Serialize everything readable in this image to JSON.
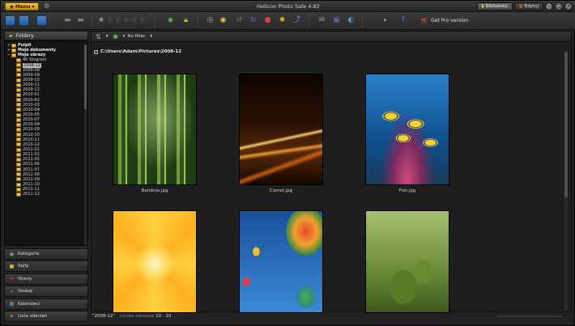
{
  "titlebar": {
    "menu_label": "Menu",
    "app_title": "Helicon Photo Safe 4.82",
    "biblioteka": "Biblioteka",
    "edytuj": "Edytuj"
  },
  "toolbar": {
    "get_pro": "Get Pro version"
  },
  "sidebar": {
    "folders_header": "Foldery",
    "tree": [
      {
        "label": "Pulpit",
        "level": 0,
        "bold": true,
        "exp": "+"
      },
      {
        "label": "Moje dokumenty",
        "level": 0,
        "bold": true,
        "exp": "+"
      },
      {
        "label": "Moje obrazy",
        "level": 0,
        "bold": true,
        "exp": "−"
      },
      {
        "label": "4K Stogram",
        "level": 1
      },
      {
        "label": "2008-12",
        "level": 1,
        "selected": true
      },
      {
        "label": "2009-08",
        "level": 1
      },
      {
        "label": "2009-09",
        "level": 1
      },
      {
        "label": "2009-10",
        "level": 1
      },
      {
        "label": "2009-11",
        "level": 1
      },
      {
        "label": "2009-12",
        "level": 1
      },
      {
        "label": "2010-01",
        "level": 1
      },
      {
        "label": "2010-02",
        "level": 1
      },
      {
        "label": "2010-03",
        "level": 1
      },
      {
        "label": "2010-04",
        "level": 1
      },
      {
        "label": "2010-05",
        "level": 1
      },
      {
        "label": "2010-07",
        "level": 1
      },
      {
        "label": "2010-08",
        "level": 1
      },
      {
        "label": "2010-09",
        "level": 1
      },
      {
        "label": "2010-10",
        "level": 1
      },
      {
        "label": "2010-11",
        "level": 1
      },
      {
        "label": "2010-12",
        "level": 1
      },
      {
        "label": "2011-01",
        "level": 1
      },
      {
        "label": "2011-02",
        "level": 1
      },
      {
        "label": "2011-05",
        "level": 1
      },
      {
        "label": "2011-06",
        "level": 1
      },
      {
        "label": "2011-07",
        "level": 1
      },
      {
        "label": "2011-08",
        "level": 1
      },
      {
        "label": "2011-09",
        "level": 1
      },
      {
        "label": "2011-10",
        "level": 1
      },
      {
        "label": "2011-11",
        "level": 1
      },
      {
        "label": "2011-12",
        "level": 1
      }
    ],
    "nav": [
      {
        "label": "Kategorie",
        "icon": "tag-icon",
        "color": "#4caf50",
        "glyph": "●"
      },
      {
        "label": "Sejfy",
        "icon": "safe-icon",
        "color": "#e0b030",
        "glyph": "■"
      },
      {
        "label": "Oceny",
        "icon": "rating-icon",
        "color": "#d03030",
        "glyph": "★"
      },
      {
        "label": "Szukaj",
        "icon": "search-icon",
        "color": "#aaaaaa",
        "glyph": "⌕"
      },
      {
        "label": "Kalendarz",
        "icon": "calendar-icon",
        "color": "#6a9ad8",
        "glyph": "▦"
      },
      {
        "label": "Lista zdarzeń",
        "icon": "events-icon",
        "color": "#8ab0d8",
        "glyph": "≡"
      }
    ]
  },
  "main": {
    "filter_label": "No filter",
    "path": "C:\\Users\\Adam\\Pictures\\2008-12",
    "thumbnails": [
      {
        "caption": "Bamboo.jpg"
      },
      {
        "caption": "Comet.jpg"
      },
      {
        "caption": "Fish.jpg"
      },
      {
        "caption": ""
      },
      {
        "caption": ""
      },
      {
        "caption": ""
      }
    ]
  },
  "status": {
    "folder": "\"2008-12\"",
    "count_label": "Liczba obrazów",
    "count_value": "10 : 10"
  }
}
